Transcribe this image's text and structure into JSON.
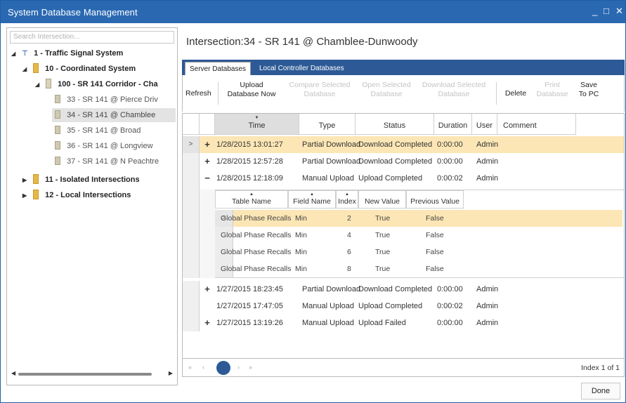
{
  "window": {
    "title": "System Database Management",
    "minimize": "_",
    "maximize": "□",
    "close": "✕"
  },
  "tree": {
    "search_placeholder": "Search Intersection...",
    "nodes": [
      {
        "label": "1 - Traffic Signal System",
        "expander": "◢",
        "icon": "system-icon"
      },
      {
        "label": "10 - Coordinated System",
        "expander": "◢",
        "icon": "folder-icon"
      },
      {
        "label": "100 - SR 141 Corridor - Cha",
        "expander": "◢",
        "icon": "folder-icon"
      },
      {
        "label": "33 - SR 141 @ Pierce Driv",
        "icon": "controller-icon"
      },
      {
        "label": "34 - SR 141 @ Chamblee",
        "icon": "controller-icon",
        "selected": true
      },
      {
        "label": "35 - SR 141 @ Broad",
        "icon": "controller-icon"
      },
      {
        "label": "36 - SR 141 @ Longview",
        "icon": "controller-icon"
      },
      {
        "label": "37 - SR 141 @ N Peachtre",
        "icon": "controller-icon"
      },
      {
        "label": "11 - Isolated Intersections",
        "expander": "▶",
        "icon": "folder-icon"
      },
      {
        "label": "12 - Local Intersections",
        "expander": "▶",
        "icon": "folder-icon"
      }
    ]
  },
  "intersection_title": "Intersection:34 - SR 141 @ Chamblee-Dunwoody",
  "tabs": [
    {
      "label": "Server Databases",
      "active": true
    },
    {
      "label": "Local Controller Databases",
      "active": false
    }
  ],
  "toolbar": {
    "refresh": "Refresh",
    "upload_now": [
      "Upload",
      "Database Now"
    ],
    "compare_selected": [
      "Compare Selected",
      "Database"
    ],
    "open_selected": [
      "Open Selected",
      "Database"
    ],
    "download_selected": [
      "Download Selected",
      "Database"
    ],
    "delete": "Delete",
    "print": [
      "Print",
      "Database"
    ],
    "save_to_pc": [
      "Save",
      "To PC"
    ]
  },
  "grid": {
    "columns": [
      "Time",
      "Type",
      "Status",
      "Duration",
      "User",
      "Comment"
    ],
    "rows_top": [
      {
        "indicator": ">",
        "expander": "+",
        "time": "1/28/2015 13:01:27",
        "type": "Partial Download",
        "status": "Download Completed",
        "duration": "0:00:00",
        "user": "Admin",
        "highlight": true
      },
      {
        "indicator": "",
        "expander": "+",
        "time": "1/28/2015 12:57:28",
        "type": "Partial Download",
        "status": "Download Completed",
        "duration": "0:00:00",
        "user": "Admin"
      },
      {
        "indicator": "",
        "expander": "−",
        "time": "1/28/2015 12:18:09",
        "type": "Manual Upload",
        "status": "Upload Completed",
        "duration": "0:00:02",
        "user": "Admin"
      }
    ],
    "detail": {
      "columns": [
        "Table Name",
        "Field Name",
        "Index",
        "New Value",
        "Previous Value"
      ],
      "rows": [
        {
          "indicator": ">",
          "table": "Global Phase Recalls",
          "field": "Min",
          "index": "2",
          "new": "True",
          "prev": "False",
          "highlight": true
        },
        {
          "indicator": "",
          "table": "Global Phase Recalls",
          "field": "Min",
          "index": "4",
          "new": "True",
          "prev": "False"
        },
        {
          "indicator": "",
          "table": "Global Phase Recalls",
          "field": "Min",
          "index": "6",
          "new": "True",
          "prev": "False"
        },
        {
          "indicator": "",
          "table": "Global Phase Recalls",
          "field": "Min",
          "index": "8",
          "new": "True",
          "prev": "False"
        }
      ]
    },
    "rows_bottom": [
      {
        "indicator": "",
        "expander": "+",
        "time": "1/27/2015 18:23:45",
        "type": "Partial Download",
        "status": "Download Completed",
        "duration": "0:00:00",
        "user": "Admin"
      },
      {
        "indicator": "",
        "expander": "",
        "time": "1/27/2015 17:47:05",
        "type": "Manual Upload",
        "status": "Upload Completed",
        "duration": "0:00:02",
        "user": "Admin"
      },
      {
        "indicator": "",
        "expander": "+",
        "time": "1/27/2015 13:19:26",
        "type": "Manual Upload",
        "status": "Upload Failed",
        "duration": "0:00:00",
        "user": "Admin"
      }
    ]
  },
  "pager": {
    "first": "«",
    "prev": "‹",
    "current": "1",
    "next": "›",
    "last": "»",
    "index_text": "Index  1  of 1"
  },
  "done": "Done",
  "colors": {
    "title_bar": "#2a69b2",
    "tab_strip": "#2d5a96",
    "row_highlight": "#fce6b5"
  }
}
